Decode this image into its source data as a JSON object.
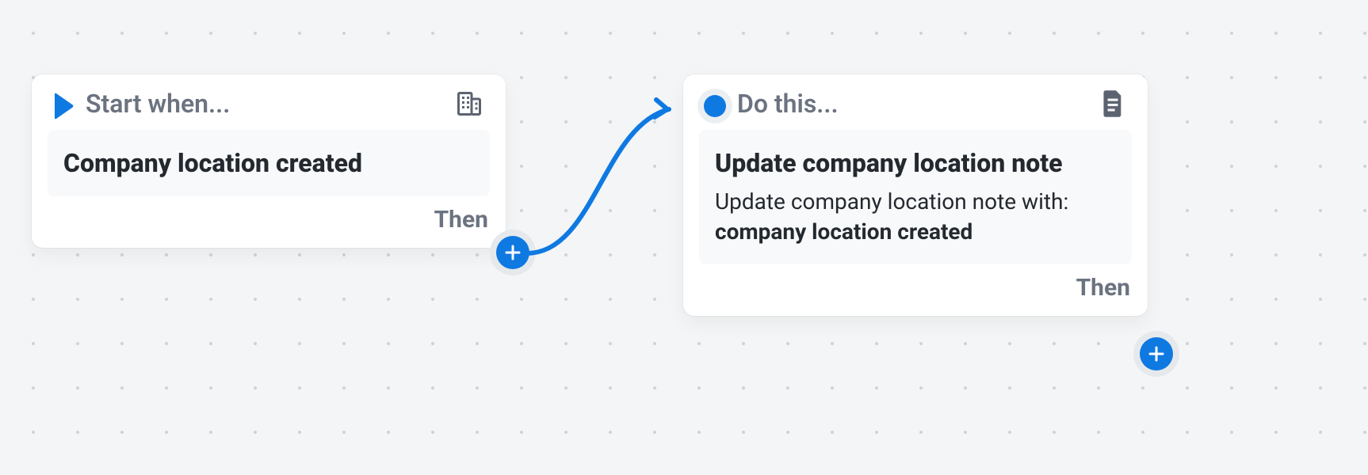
{
  "colors": {
    "accent": "#0f79e2"
  },
  "connector": {
    "arrow": true
  },
  "cards": [
    {
      "header_label": "Start when...",
      "icon": "building-icon",
      "title": "Company location created",
      "description_prefix": "",
      "description_strong": "",
      "footer_label": "Then",
      "badge": "play"
    },
    {
      "header_label": "Do this...",
      "icon": "document-icon",
      "title": "Update company location note",
      "description_prefix": "Update company location note with: ",
      "description_strong": "company location created",
      "footer_label": "Then",
      "badge": "dot"
    }
  ]
}
